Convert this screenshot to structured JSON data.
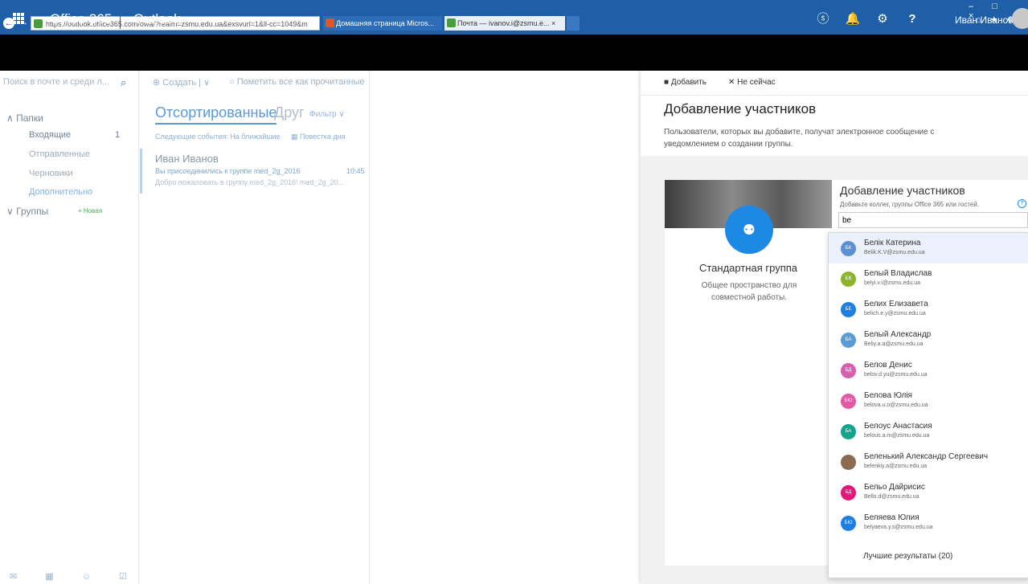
{
  "browser": {
    "url": "https://outlook.office365.com/owa/?realm=zsmu.edu.ua&exsvurl=1&ll-cc=1049&m",
    "addr_controls": "⌕ ▾ 🔒 ↻",
    "tab1": "Домашняя страница Micros...",
    "tab2": "Почта — ivanov.i@zsmu.e...",
    "tab2_close": "×",
    "win_controls": "– □ ×",
    "icons": "⌂ ★ ⚙"
  },
  "appbar": {
    "office": "Office 365",
    "app": "Outlook",
    "skype": "ⓢ",
    "bell": "🔔",
    "gear": "⚙",
    "help": "?",
    "user": "Иван Иванов"
  },
  "nav": {
    "search_placeholder": "Поиск в почте и среди л...",
    "search_icon": "⌕",
    "folders_header": "∧ Папки",
    "inbox": "Входящие",
    "inbox_count": "1",
    "sent": "Отправленные",
    "drafts": "Черновики",
    "more": "Дополнительно",
    "groups_header": "∨ Группы",
    "groups_new": "+ Новая",
    "bottom_icons": "✉ ▦ ☺ ☑"
  },
  "list": {
    "create": "⊕ Создать | ∨",
    "mark_read": "○ Пометить все как прочитанные",
    "tab_focused": "Отсортированные",
    "tab_other": "Друг",
    "filter": "Фильтр ∨",
    "next_event": "Следующие события: На ближайшие",
    "agenda": "▦ Повестка дня",
    "mail_sender": "Иван Иванов",
    "mail_subject": "Вы присоединились к группе med_2g_2016",
    "mail_time": "10:45",
    "mail_preview": "Добро пожаловать в группу med_2g_2016! med_2g_20..."
  },
  "panel": {
    "add": "■ Добавить",
    "not_now": "✕ Не сейчас",
    "title": "Добавление участников",
    "desc": "Пользователи, которых вы добавите, получат электронное сообщение с уведомлением о создании группы.",
    "group_icon": "⚉",
    "group_type": "Стандартная группа",
    "group_desc": "Общее пространство для совместной работы.",
    "add_title": "Добавление участников",
    "add_hint": "Добавьте коллег, группы Office 365 или гостей.",
    "hint_icon": "?",
    "input_value": "be",
    "best_results": "Лучшие результаты (20)"
  },
  "suggestions": [
    {
      "initials": "БК",
      "name": "Белік Катерина",
      "email": "Belik.K.V@zsmu.edu.ua",
      "color": "#5b8fd6",
      "highlighted": true
    },
    {
      "initials": "БВ",
      "name": "Белый Владислав",
      "email": "belyi.v.i@zsmu.edu.ua",
      "color": "#8bb42a"
    },
    {
      "initials": "БЕ",
      "name": "Белих Елизавета",
      "email": "belich.e.y@zsmu.edu.ua",
      "color": "#1e7fe0"
    },
    {
      "initials": "БА",
      "name": "Белый Александр",
      "email": "Beliy.a.a@zsmu.edu.ua",
      "color": "#5b9bd5"
    },
    {
      "initials": "БД",
      "name": "Белов Денис",
      "email": "belov.d.yu@zsmu.edu.ua",
      "color": "#d65fb0"
    },
    {
      "initials": "БЮ",
      "name": "Белова Юлія",
      "email": "belova.u.o@zsmu.edu.ua",
      "color": "#e05aa6"
    },
    {
      "initials": "БА",
      "name": "Белоус Анастасия",
      "email": "belous.a.m@zsmu.edu.ua",
      "color": "#14a38b"
    },
    {
      "initials": "",
      "name": "Беленький Александр Сергеевич",
      "email": "belenkiy.a@zsmu.edu.ua",
      "color": "#8a6a50",
      "photo": true
    },
    {
      "initials": "БД",
      "name": "Бельо Дайрисис",
      "email": "Bello.d@zsmu.edu.ua",
      "color": "#e0187a"
    },
    {
      "initials": "БЮ",
      "name": "Беляева Юлия",
      "email": "belyaeva.y.s@zsmu.edu.ua",
      "color": "#1e7fe0"
    }
  ]
}
